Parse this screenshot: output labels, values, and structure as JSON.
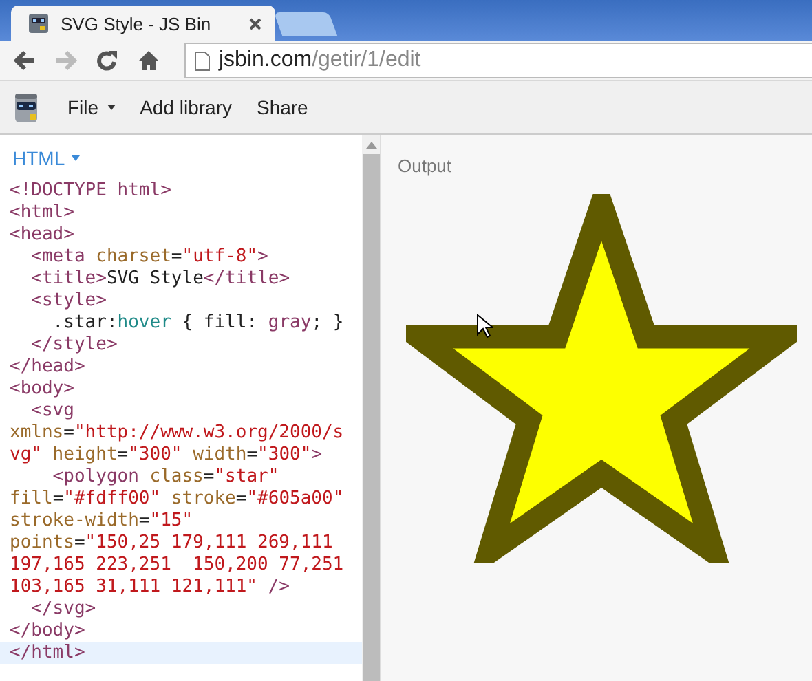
{
  "browser": {
    "tabs": [
      {
        "title": "SVG Style - JS Bin",
        "selected": true
      },
      {
        "selected": false
      }
    ],
    "nav": [
      {
        "kind": "back",
        "disabled": false
      },
      {
        "kind": "forward",
        "disabled": true
      },
      {
        "kind": "reload",
        "disabled": false
      },
      {
        "kind": "home",
        "disabled": false
      }
    ],
    "address": {
      "host": "jsbin.com",
      "path": "/getir/1/edit"
    }
  },
  "menu": [
    {
      "label": "File",
      "dropdown": true
    },
    {
      "label": "Add library",
      "dropdown": false
    },
    {
      "label": "Share",
      "dropdown": false
    }
  ],
  "editor": {
    "panel": "HTML",
    "lines": [
      {
        "current": false,
        "tokens": [
          {
            "kind": "tag",
            "text": "<!DOCTYPE html>"
          }
        ]
      },
      {
        "current": false,
        "tokens": [
          {
            "kind": "tag",
            "text": "<html>"
          }
        ]
      },
      {
        "current": false,
        "tokens": [
          {
            "kind": "tag",
            "text": "<head>"
          }
        ]
      },
      {
        "current": false,
        "tokens": [
          {
            "kind": "tag",
            "text": "  <meta"
          },
          {
            "kind": "attr",
            "text": " charset"
          },
          {
            "kind": "plain",
            "text": "="
          },
          {
            "kind": "string",
            "text": "\"utf-8\""
          },
          {
            "kind": "tag",
            "text": ">"
          }
        ]
      },
      {
        "current": false,
        "tokens": [
          {
            "kind": "tag",
            "text": "  <title>"
          },
          {
            "kind": "plain",
            "text": "SVG Style"
          },
          {
            "kind": "tag",
            "text": "</title>"
          }
        ]
      },
      {
        "current": false,
        "tokens": [
          {
            "kind": "tag",
            "text": "  <style>"
          }
        ]
      },
      {
        "current": false,
        "tokens": [
          {
            "kind": "plain",
            "text": "    .star:"
          },
          {
            "kind": "keyword",
            "text": "hover"
          },
          {
            "kind": "plain",
            "text": " { fill: "
          },
          {
            "kind": "value",
            "text": "gray"
          },
          {
            "kind": "plain",
            "text": "; }"
          }
        ]
      },
      {
        "current": false,
        "tokens": [
          {
            "kind": "tag",
            "text": "  </style>"
          }
        ]
      },
      {
        "current": false,
        "tokens": [
          {
            "kind": "tag",
            "text": "</head>"
          }
        ]
      },
      {
        "current": false,
        "tokens": [
          {
            "kind": "tag",
            "text": "<body>"
          }
        ]
      },
      {
        "current": false,
        "tokens": [
          {
            "kind": "tag",
            "text": "  <svg"
          }
        ]
      },
      {
        "current": false,
        "tokens": [
          {
            "kind": "attr",
            "text": "xmlns"
          },
          {
            "kind": "plain",
            "text": "="
          },
          {
            "kind": "string",
            "text": "\"http://www.w3.org/2000/s"
          }
        ]
      },
      {
        "current": false,
        "tokens": [
          {
            "kind": "string",
            "text": "vg\""
          },
          {
            "kind": "attr",
            "text": " height"
          },
          {
            "kind": "plain",
            "text": "="
          },
          {
            "kind": "string",
            "text": "\"300\""
          },
          {
            "kind": "attr",
            "text": " width"
          },
          {
            "kind": "plain",
            "text": "="
          },
          {
            "kind": "string",
            "text": "\"300\""
          },
          {
            "kind": "tag",
            "text": ">"
          }
        ]
      },
      {
        "current": false,
        "tokens": [
          {
            "kind": "tag",
            "text": "    <polygon"
          },
          {
            "kind": "attr",
            "text": " class"
          },
          {
            "kind": "plain",
            "text": "="
          },
          {
            "kind": "string",
            "text": "\"star\""
          }
        ]
      },
      {
        "current": false,
        "tokens": [
          {
            "kind": "attr",
            "text": "fill"
          },
          {
            "kind": "plain",
            "text": "="
          },
          {
            "kind": "string",
            "text": "\"#fdff00\""
          },
          {
            "kind": "attr",
            "text": " stroke"
          },
          {
            "kind": "plain",
            "text": "="
          },
          {
            "kind": "string",
            "text": "\"#605a00\""
          }
        ]
      },
      {
        "current": false,
        "tokens": [
          {
            "kind": "attr",
            "text": "stroke-width"
          },
          {
            "kind": "plain",
            "text": "="
          },
          {
            "kind": "string",
            "text": "\"15\""
          }
        ]
      },
      {
        "current": false,
        "tokens": [
          {
            "kind": "attr",
            "text": "points"
          },
          {
            "kind": "plain",
            "text": "="
          },
          {
            "kind": "string",
            "text": "\"150,25 179,111 269,111"
          }
        ]
      },
      {
        "current": false,
        "tokens": [
          {
            "kind": "string",
            "text": "197,165 223,251  150,200 77,251"
          }
        ]
      },
      {
        "current": false,
        "tokens": [
          {
            "kind": "string",
            "text": "103,165 31,111 121,111\""
          },
          {
            "kind": "tag",
            "text": " />"
          }
        ]
      },
      {
        "current": false,
        "tokens": [
          {
            "kind": "tag",
            "text": "  </svg>"
          }
        ]
      },
      {
        "current": false,
        "tokens": [
          {
            "kind": "tag",
            "text": "</body>"
          }
        ]
      },
      {
        "current": true,
        "tokens": [
          {
            "kind": "tag",
            "text": "</html>"
          }
        ]
      }
    ]
  },
  "output": {
    "label": "Output"
  }
}
